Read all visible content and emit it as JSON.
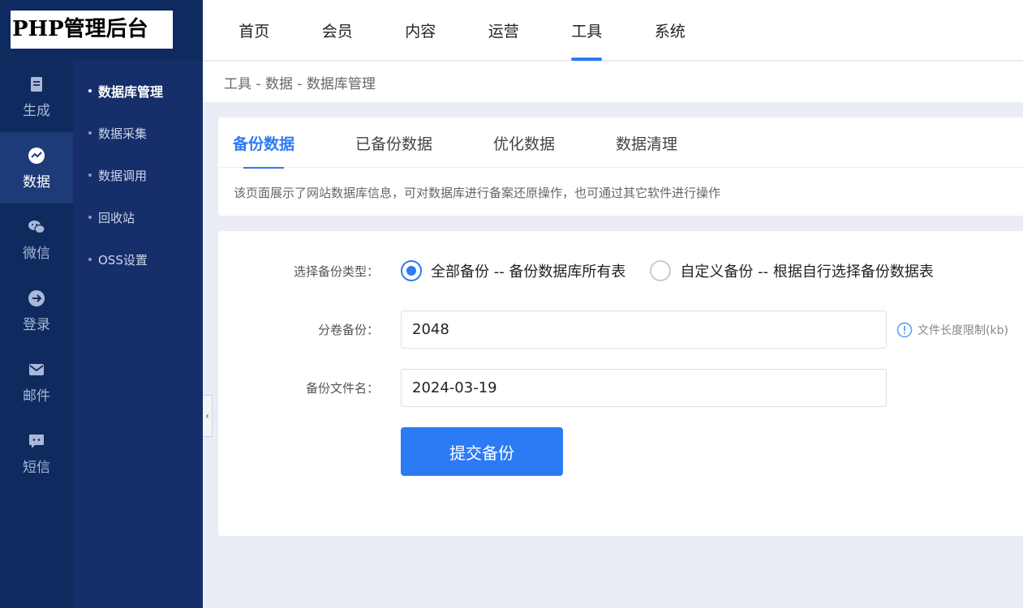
{
  "logo": {
    "text": "PHP管理后台"
  },
  "rail": {
    "items": [
      {
        "label": "生成",
        "icon": "file-icon",
        "active": false
      },
      {
        "label": "数据",
        "icon": "chart-icon",
        "active": true
      },
      {
        "label": "微信",
        "icon": "wechat-icon",
        "active": false
      },
      {
        "label": "登录",
        "icon": "login-icon",
        "active": false
      },
      {
        "label": "邮件",
        "icon": "mail-icon",
        "active": false
      },
      {
        "label": "短信",
        "icon": "sms-icon",
        "active": false
      }
    ]
  },
  "subnav": {
    "items": [
      {
        "label": "数据库管理",
        "active": true
      },
      {
        "label": "数据采集",
        "active": false
      },
      {
        "label": "数据调用",
        "active": false
      },
      {
        "label": "回收站",
        "active": false
      },
      {
        "label": "OSS设置",
        "active": false
      }
    ]
  },
  "topnav": {
    "items": [
      {
        "label": "首页"
      },
      {
        "label": "会员"
      },
      {
        "label": "内容"
      },
      {
        "label": "运营"
      },
      {
        "label": "工具"
      },
      {
        "label": "系统"
      }
    ],
    "active_index": 4
  },
  "breadcrumb": {
    "text": "工具 - 数据 - 数据库管理"
  },
  "tabs": {
    "items": [
      {
        "label": "备份数据"
      },
      {
        "label": "已备份数据"
      },
      {
        "label": "优化数据"
      },
      {
        "label": "数据清理"
      }
    ],
    "active_index": 0,
    "description": "该页面展示了网站数据库信息，可对数据库进行备案还原操作，也可通过其它软件进行操作"
  },
  "form": {
    "backup_type": {
      "label": "选择备份类型：",
      "options": [
        {
          "label": "全部备份 -- 备份数据库所有表",
          "checked": true
        },
        {
          "label": "自定义备份 -- 根据自行选择备份数据表",
          "checked": false
        }
      ]
    },
    "volume": {
      "label": "分卷备份：",
      "value": "2048",
      "hint": "文件长度限制(kb)"
    },
    "filename": {
      "label": "备份文件名：",
      "value": "2024-03-19"
    },
    "submit_label": "提交备份"
  },
  "colors": {
    "accent": "#2d7bf4",
    "rail_bg": "#0f2a5e",
    "subnav_bg": "#162f6a",
    "page_bg": "#eaedf5"
  }
}
